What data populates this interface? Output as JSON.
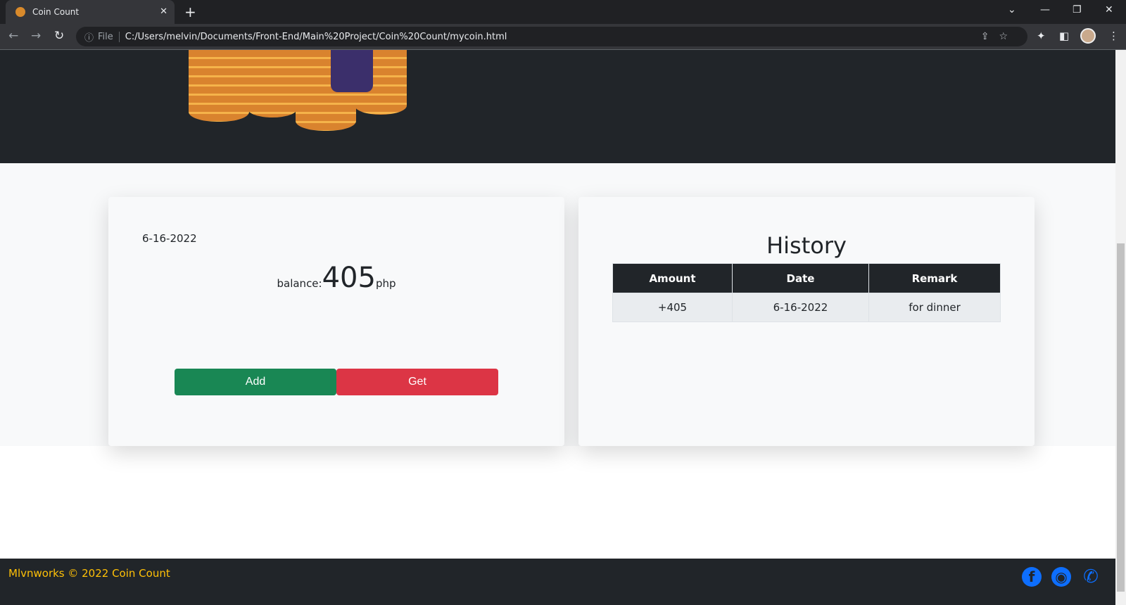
{
  "browser": {
    "tab_title": "Coin Count",
    "url": "C:/Users/melvin/Documents/Front-End/Main%20Project/Coin%20Count/mycoin.html",
    "file_label": "File"
  },
  "wallet": {
    "date": "6-16-2022",
    "balance_label": "balance:",
    "balance": "405",
    "currency": "php",
    "add_label": "Add",
    "get_label": "Get",
    "add_color": "#198754",
    "get_color": "#dc3545"
  },
  "history": {
    "title": "History",
    "columns": [
      "Amount",
      "Date",
      "Remark"
    ],
    "rows": [
      [
        "+405",
        "6-16-2022",
        "for dinner"
      ]
    ]
  },
  "footer": {
    "copyright": "Mlvnworks © 2022 Coin Count",
    "icons": [
      "facebook-icon",
      "github-icon",
      "phone-icon"
    ],
    "icon_color": "#0d6efd"
  }
}
